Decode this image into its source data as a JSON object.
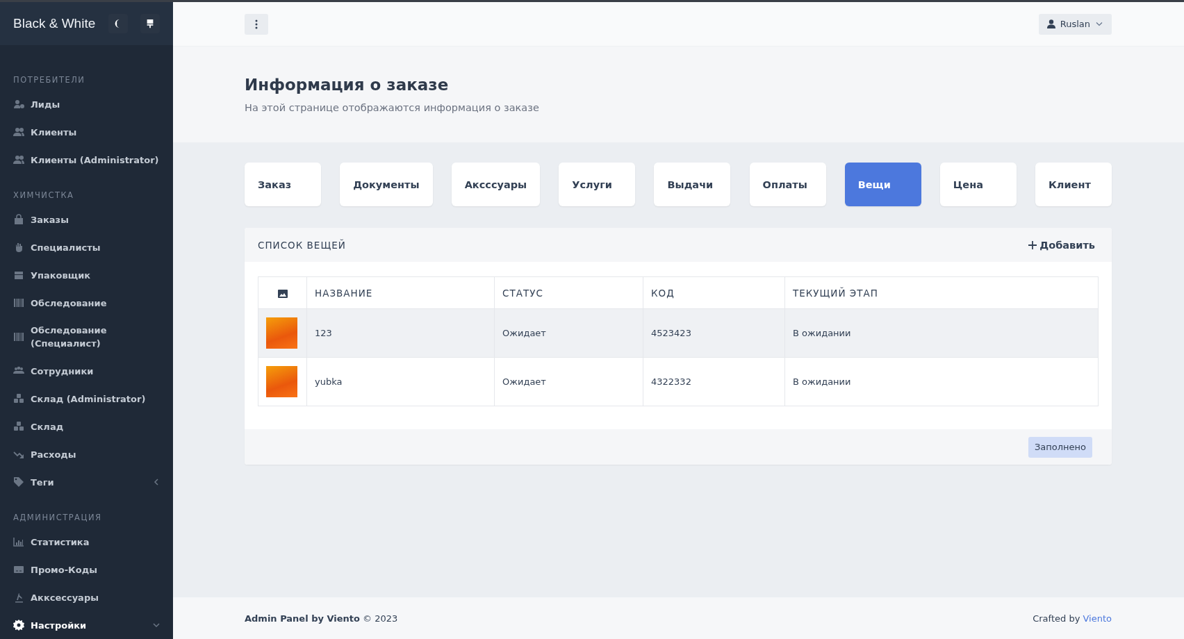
{
  "sidebar": {
    "brand": "Black & White",
    "sections": [
      {
        "title": "ПОТРЕБИТЕЛИ",
        "items": [
          {
            "label": "Лиды",
            "selected": false
          },
          {
            "label": "Клиенты",
            "selected": false
          },
          {
            "label": "Клиенты (Administrator)",
            "selected": false
          }
        ]
      },
      {
        "title": "ХИМЧИСТКА",
        "items": [
          {
            "label": "Заказы",
            "selected": false
          },
          {
            "label": "Специалисты",
            "selected": false
          },
          {
            "label": "Упаковщик",
            "selected": false
          },
          {
            "label": "Обследование",
            "selected": false
          },
          {
            "label": "Обследование (Специалист)",
            "selected": false
          },
          {
            "label": "Сотрудники",
            "selected": false
          },
          {
            "label": "Склад (Administrator)",
            "selected": false
          },
          {
            "label": "Склад",
            "selected": false
          },
          {
            "label": "Расходы",
            "selected": false
          },
          {
            "label": "Теги",
            "selected": false,
            "expanded": false
          }
        ]
      },
      {
        "title": "АДМИНИСТРАЦИЯ",
        "items": [
          {
            "label": "Статистика",
            "selected": false
          },
          {
            "label": "Промо-Коды",
            "selected": false
          },
          {
            "label": "Акксессуары",
            "selected": false
          },
          {
            "label": "Настройки",
            "selected": true,
            "expanded": true
          }
        ]
      }
    ]
  },
  "header": {
    "user": "Ruslan"
  },
  "page": {
    "title": "Информация о заказе",
    "subtitle": "На этой странице отображаются информация о заказе"
  },
  "tabs": [
    {
      "label": "Заказ",
      "selected": false
    },
    {
      "label": "Документы",
      "selected": false
    },
    {
      "label": "Аксссуары",
      "selected": false
    },
    {
      "label": "Услуги",
      "selected": false
    },
    {
      "label": "Выдачи",
      "selected": false
    },
    {
      "label": "Оплаты",
      "selected": false
    },
    {
      "label": "Вещи",
      "selected": true
    },
    {
      "label": "Цена",
      "selected": false
    },
    {
      "label": "Клиент",
      "selected": false
    }
  ],
  "card": {
    "title": "СПИСОК ВЕЩЕЙ",
    "add_button": "Добавить",
    "table": {
      "columns": [
        "НАЗВАНИЕ",
        "СТАТУС",
        "КОД",
        "ТЕКУЩИЙ ЭТАП"
      ],
      "rows": [
        {
          "name": "123",
          "status": "Ожидает",
          "code": "4523423",
          "stage": "В ожидании",
          "highlighted": true
        },
        {
          "name": "yubka",
          "status": "Ожидает",
          "code": "4322332",
          "stage": "В ожидании",
          "highlighted": false
        }
      ]
    },
    "footer_button": "Заполнено"
  },
  "footer": {
    "left": "**Admin Panel by Viento** © 2023",
    "right": "Crafted by",
    "link": "Viento"
  }
}
